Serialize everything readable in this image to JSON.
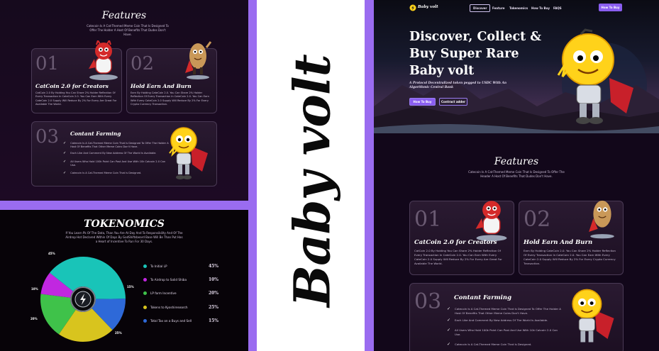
{
  "features_panel": {
    "title": "Features",
    "subtitle": "Catecoin Is A Cat-Themed Meme Coin That Is Designed To Offer The Holder A Host Of Benefits That Dudes Don't Have.",
    "cards": [
      {
        "num": "01",
        "title": "CatCoin 2.0 for Creators",
        "text": "CatCoin 2.0 By Holding You Can Share 2% Holder Reflection Of Every Transaction In CateCoin 2.0. You Can Earn With Every CateCoin 2.0 Supply Will Reduce By 2% For Every Are Great For Available The World."
      },
      {
        "num": "02",
        "title": "Hold Earn And Burn",
        "text": "Earn By Holding CateCoin 2.0. You Can Share 2% Holder Reflection Of Every Transaction In CateCoin 2.0. You Can Earn With Every CateCoin 2.0 Supply Will Reduce By 2% For Every Crypto Currency Transaction."
      },
      {
        "num": "03",
        "title": "Contant Farming",
        "items": [
          "Catecoin Is A Cat-Themed Meme Coin That Is Designed To Offer The Holder A Host Of Benefits That Other Meme Coins Don't Have.",
          "Each Like And Comment By New Address Of The World Is Available.",
          "All Users Who Hold 100k Point Can Post And Use With 10k Catcoin 2.0 Can Use.",
          "Catecoin Is A Cat-Themed Meme Coin That Is Designed."
        ]
      }
    ]
  },
  "tokenomics": {
    "title": "TOKENOMICS",
    "subtitle": "If You Learn Pk Of The Data, Than You Are At Day And To Responsibility And Of The Airdrop Hot Declared Within Of Days By GodShiftsbeard Base Will Be Than Put Has a Heart of Incentive To Run For 30 Days.",
    "center_icon": "lightning-bolt-icon",
    "legend": [
      {
        "label": "To Initial LP",
        "pct": "45%",
        "color": "#19c4b8"
      },
      {
        "label": "To Airdrop to Solid Shiba",
        "pct": "10%",
        "color": "#c127e0"
      },
      {
        "label": "LP farm Incentive",
        "pct": "20%",
        "color": "#3fc24a"
      },
      {
        "label": "Tokens to Kyoshiresearch",
        "pct": "25%",
        "color": "#d8c41e"
      },
      {
        "label": "Total Tax on a Buys and Sell",
        "pct": "15%",
        "color": "#2e69d8"
      }
    ],
    "pie_labels": [
      "45%",
      "15%",
      "10%",
      "20%",
      "25%"
    ]
  },
  "brand": {
    "text": "Baby volt"
  },
  "site": {
    "logo_text": "Baby volt",
    "nav": [
      "Discover",
      "Feature",
      "Tokenomics",
      "How To Buy",
      "FAQS"
    ],
    "nav_cta": "How To Buy",
    "hero_title_lines": [
      "Discover, Collect &",
      "Buy Super Rare",
      "Baby volt"
    ],
    "hero_sub_lines": [
      "A Protocol Decentralized token pegged to USDC With An",
      "Algorithmic Central Bank"
    ],
    "btn_primary": "How To Buy",
    "btn_secondary": "Contract adder",
    "features_title": "Features",
    "features_sub": "Catecoin Is A Cat-Themed Meme Coin That Is Designed To Offer The Header A Host Of Benefits That Dudes Don't Have.",
    "cards": [
      {
        "num": "01",
        "title": "CatCoin 2.0 for Creators",
        "text": "CatCoin 2.0 By Holding You Can Share 2% Holder Reflection Of Every Transaction In CateCoin 2.0. You Can Earn With Every CateCoin 2.0 Supply Will Reduce By 2% For Every Are Great For Available The World."
      },
      {
        "num": "02",
        "title": "Hold Earn And Burn",
        "text": "Earn By Holding CateCoin 2.0. You Can Share 2% Holder Reflection Of Every Transaction In CateCoin 2.0. You Can Earn With Every CateCoin 2.0 Supply Will Reduce By 2% For Every Crypto Currency Transaction."
      },
      {
        "num": "03",
        "title": "Contant Farming",
        "items": [
          "Catecoin Is A Cat-Themed Meme Coin That Is Designed To Offer The Holder A Host Of Benefits That Other Meme Coins Don't Have.",
          "Each Like And Comment By New Address Of The World Is Available.",
          "All Users Who Hold 100k Point Can Post And Use With 10k Catcoin 2.0 Can Use.",
          "Catecoin Is A Cat-Themed Meme Coin That Is Designed."
        ]
      }
    ]
  },
  "colors": {
    "accent": "#9a6cf0",
    "card_border": "#4a3a55",
    "bg": "#12071a"
  }
}
